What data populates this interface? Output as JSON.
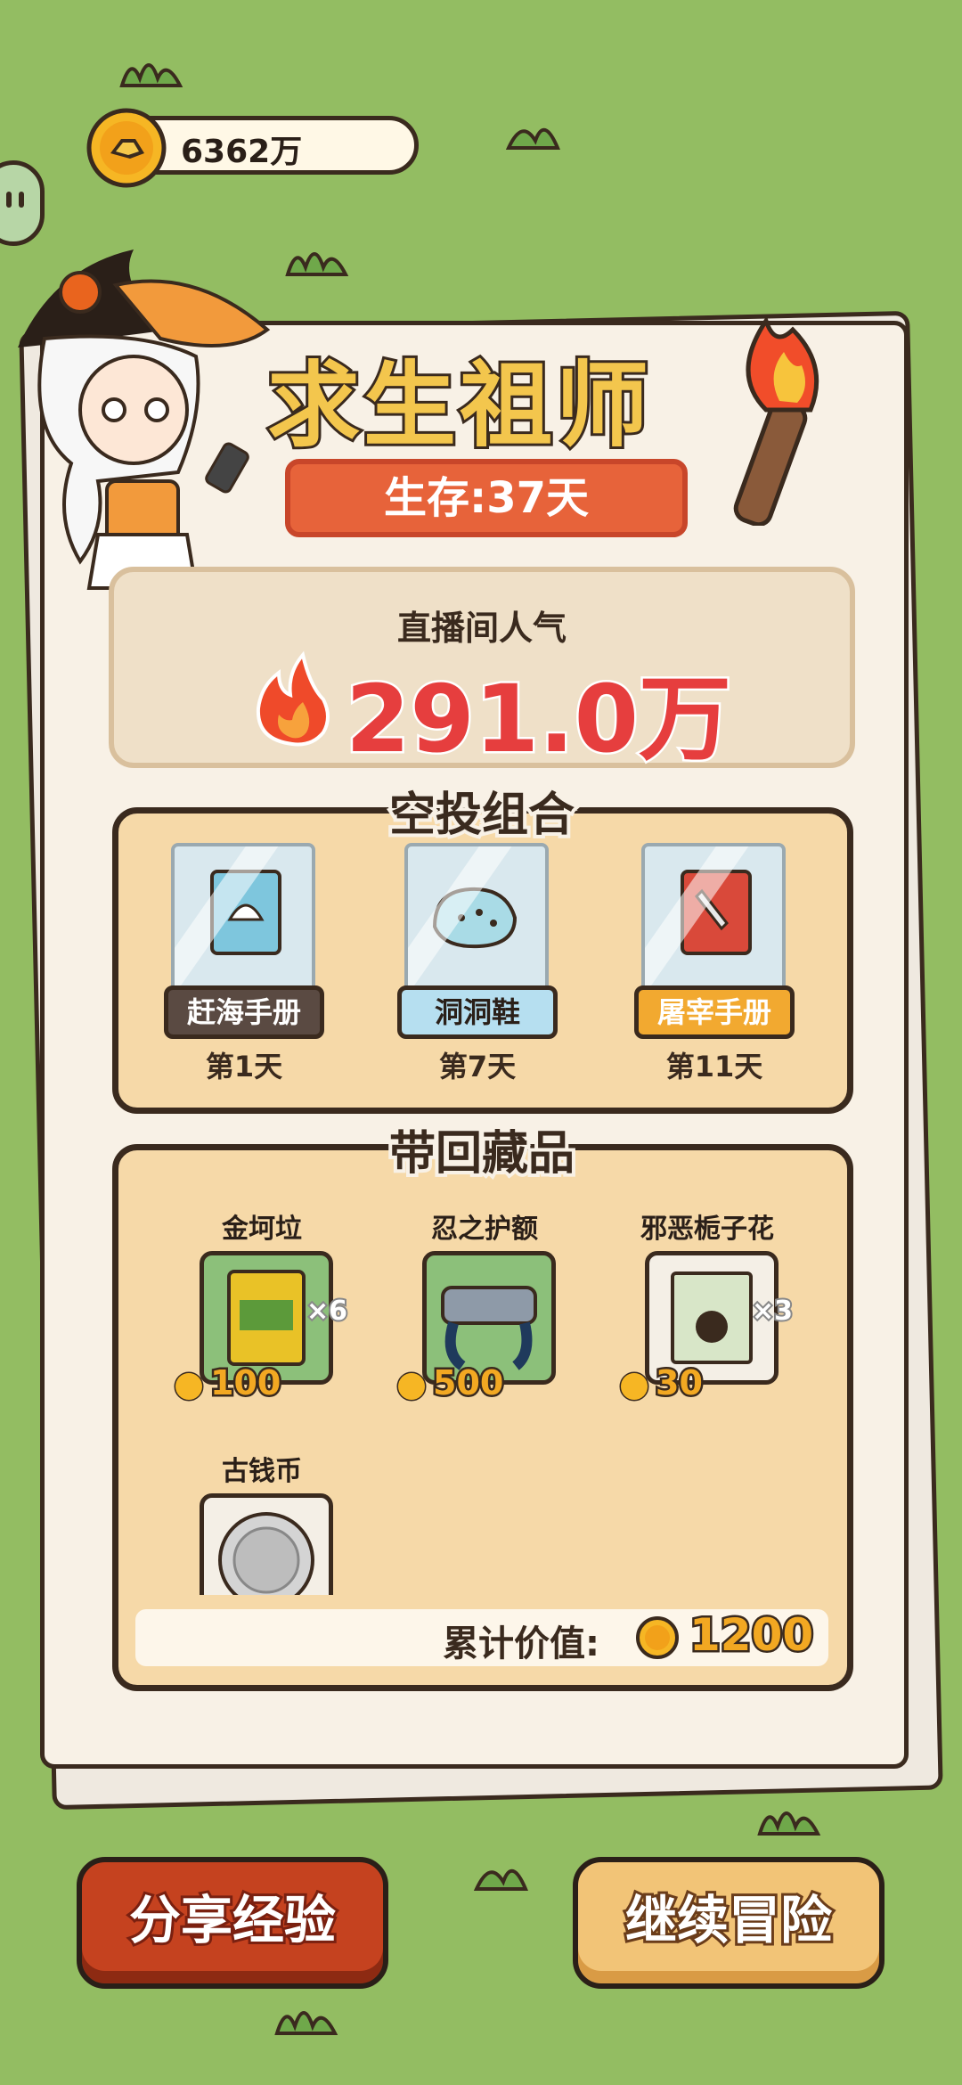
{
  "header": {
    "coin_amount": "6362万"
  },
  "main": {
    "title": "求生祖师",
    "survive_text": "生存:37天",
    "popularity_label": "直播间人气",
    "popularity_value": "291.0万"
  },
  "airdrop": {
    "title": "空投组合",
    "items": [
      {
        "label": "赶海手册",
        "day": "第1天"
      },
      {
        "label": "洞洞鞋",
        "day": "第7天"
      },
      {
        "label": "屠宰手册",
        "day": "第11天"
      }
    ]
  },
  "collection": {
    "title": "带回藏品",
    "items": [
      {
        "name": "金坷垃",
        "mult": "×6",
        "price": "100"
      },
      {
        "name": "忍之护额",
        "mult": "",
        "price": "500"
      },
      {
        "name": "邪恶栀子花",
        "mult": "×3",
        "price": "30"
      },
      {
        "name": "古钱币",
        "mult": "",
        "price": ""
      }
    ],
    "total_label": "累计价值:",
    "total_value": "1200"
  },
  "buttons": {
    "share": "分享经验",
    "continue": "继续冒险"
  },
  "colors": {
    "background": "#93bd62",
    "gold": "#f2a822",
    "red_accent": "#e63e3e",
    "survive_pill": "#e7633a"
  }
}
